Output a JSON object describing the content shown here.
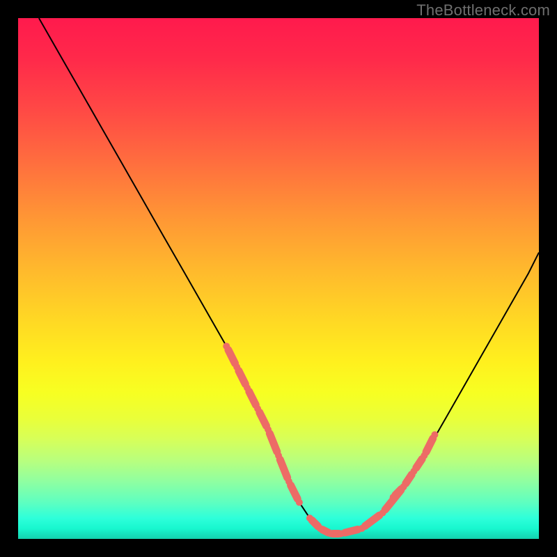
{
  "watermark": "TheBottleneck.com",
  "colors": {
    "page_bg": "#000000",
    "curve": "#000000",
    "marker": "#ed6b66",
    "gradient_top": "#ff1a4d",
    "gradient_mid": "#ffd824",
    "gradient_bottom": "#14d1ae"
  },
  "chart_data": {
    "type": "line",
    "title": "",
    "xlabel": "",
    "ylabel": "",
    "xlim": [
      0,
      100
    ],
    "ylim": [
      0,
      100
    ],
    "grid": false,
    "legend": false,
    "annotations": [],
    "series": [
      {
        "name": "curve",
        "x": [
          4,
          8,
          12,
          16,
          20,
          24,
          28,
          32,
          36,
          40,
          42,
          44,
          46,
          48,
          50,
          52,
          54,
          56,
          58,
          60,
          62,
          66,
          70,
          74,
          78,
          82,
          86,
          90,
          94,
          98,
          100
        ],
        "y": [
          100,
          93,
          86,
          79,
          72,
          65,
          58,
          51,
          44,
          37,
          33,
          29,
          25,
          21,
          16,
          11,
          7,
          4,
          2,
          1,
          1,
          2,
          5,
          10,
          16,
          23,
          30,
          37,
          44,
          51,
          55
        ]
      }
    ],
    "highlight_segments": [
      {
        "x": [
          40,
          42,
          44,
          46,
          48,
          50,
          52,
          54
        ],
        "y": [
          37,
          33,
          29,
          25,
          21,
          16,
          11,
          7
        ]
      },
      {
        "x": [
          56,
          58,
          60,
          62,
          66,
          70,
          74
        ],
        "y": [
          4,
          2,
          1,
          1,
          2,
          5,
          10
        ]
      },
      {
        "x": [
          72,
          74,
          76,
          78,
          80
        ],
        "y": [
          8,
          10,
          13,
          16,
          20
        ]
      }
    ]
  }
}
